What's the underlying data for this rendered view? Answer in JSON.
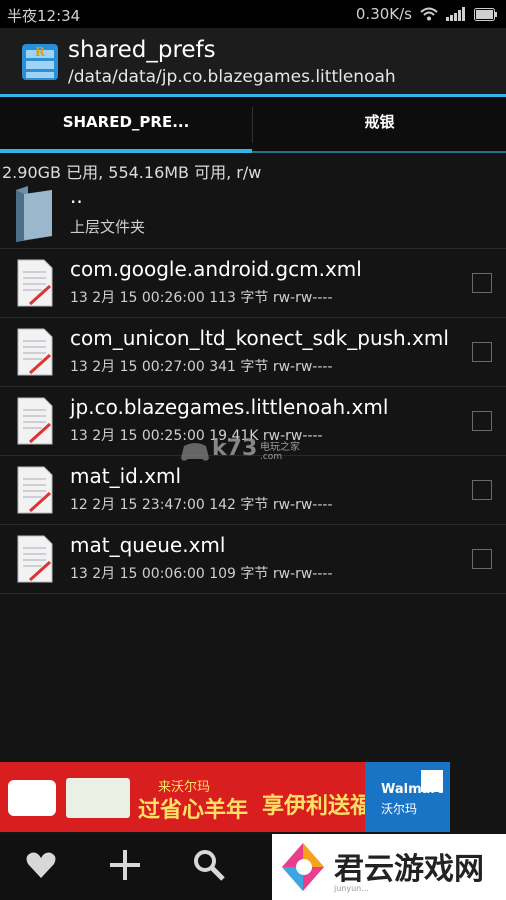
{
  "status_bar": {
    "time": "半夜12:34",
    "net_speed": "0.30K/s",
    "icons": [
      "wifi-icon",
      "signal-icon",
      "battery-icon"
    ]
  },
  "header": {
    "title": "shared_prefs",
    "path": "/data/data/jp.co.blazegames.littlenoah",
    "accent_color": "#33b5e5"
  },
  "tabs": [
    {
      "label": "SHARED_PRE...",
      "active": true
    },
    {
      "label": "戒银",
      "active": false
    }
  ],
  "storage_info": "2.90GB 已用, 554.16MB 可用, r/w",
  "parent": {
    "name": "..",
    "label": "上层文件夹"
  },
  "files": [
    {
      "name": "com.google.android.gcm.xml",
      "meta": "13 2月 15 00:26:00  113 字节  rw-rw----"
    },
    {
      "name": "com_unicon_ltd_konect_sdk_push.xml",
      "meta": "13 2月 15 00:27:00  341 字节  rw-rw----"
    },
    {
      "name": "jp.co.blazegames.littlenoah.xml",
      "meta": "13 2月 15 00:25:00  19.41K  rw-rw----"
    },
    {
      "name": "mat_id.xml",
      "meta": "12 2月 15 23:47:00  142 字节  rw-rw----"
    },
    {
      "name": "mat_queue.xml",
      "meta": "13 2月 15 00:06:00  109 字节  rw-rw----"
    }
  ],
  "watermark": {
    "brand": "k73",
    "sub": "电玩之家",
    "domain": ".com"
  },
  "ad_banner": {
    "line1": "来沃尔玛",
    "line2": "过省心羊年",
    "line3": "享伊利送福",
    "store_en": "Walmart",
    "store_cn": "沃尔玛"
  },
  "bottom_bar": {
    "icons": [
      "favorite-icon",
      "add-icon",
      "search-icon"
    ]
  },
  "brand_badge": {
    "text": "君云游戏网",
    "sub": "junyun..."
  }
}
